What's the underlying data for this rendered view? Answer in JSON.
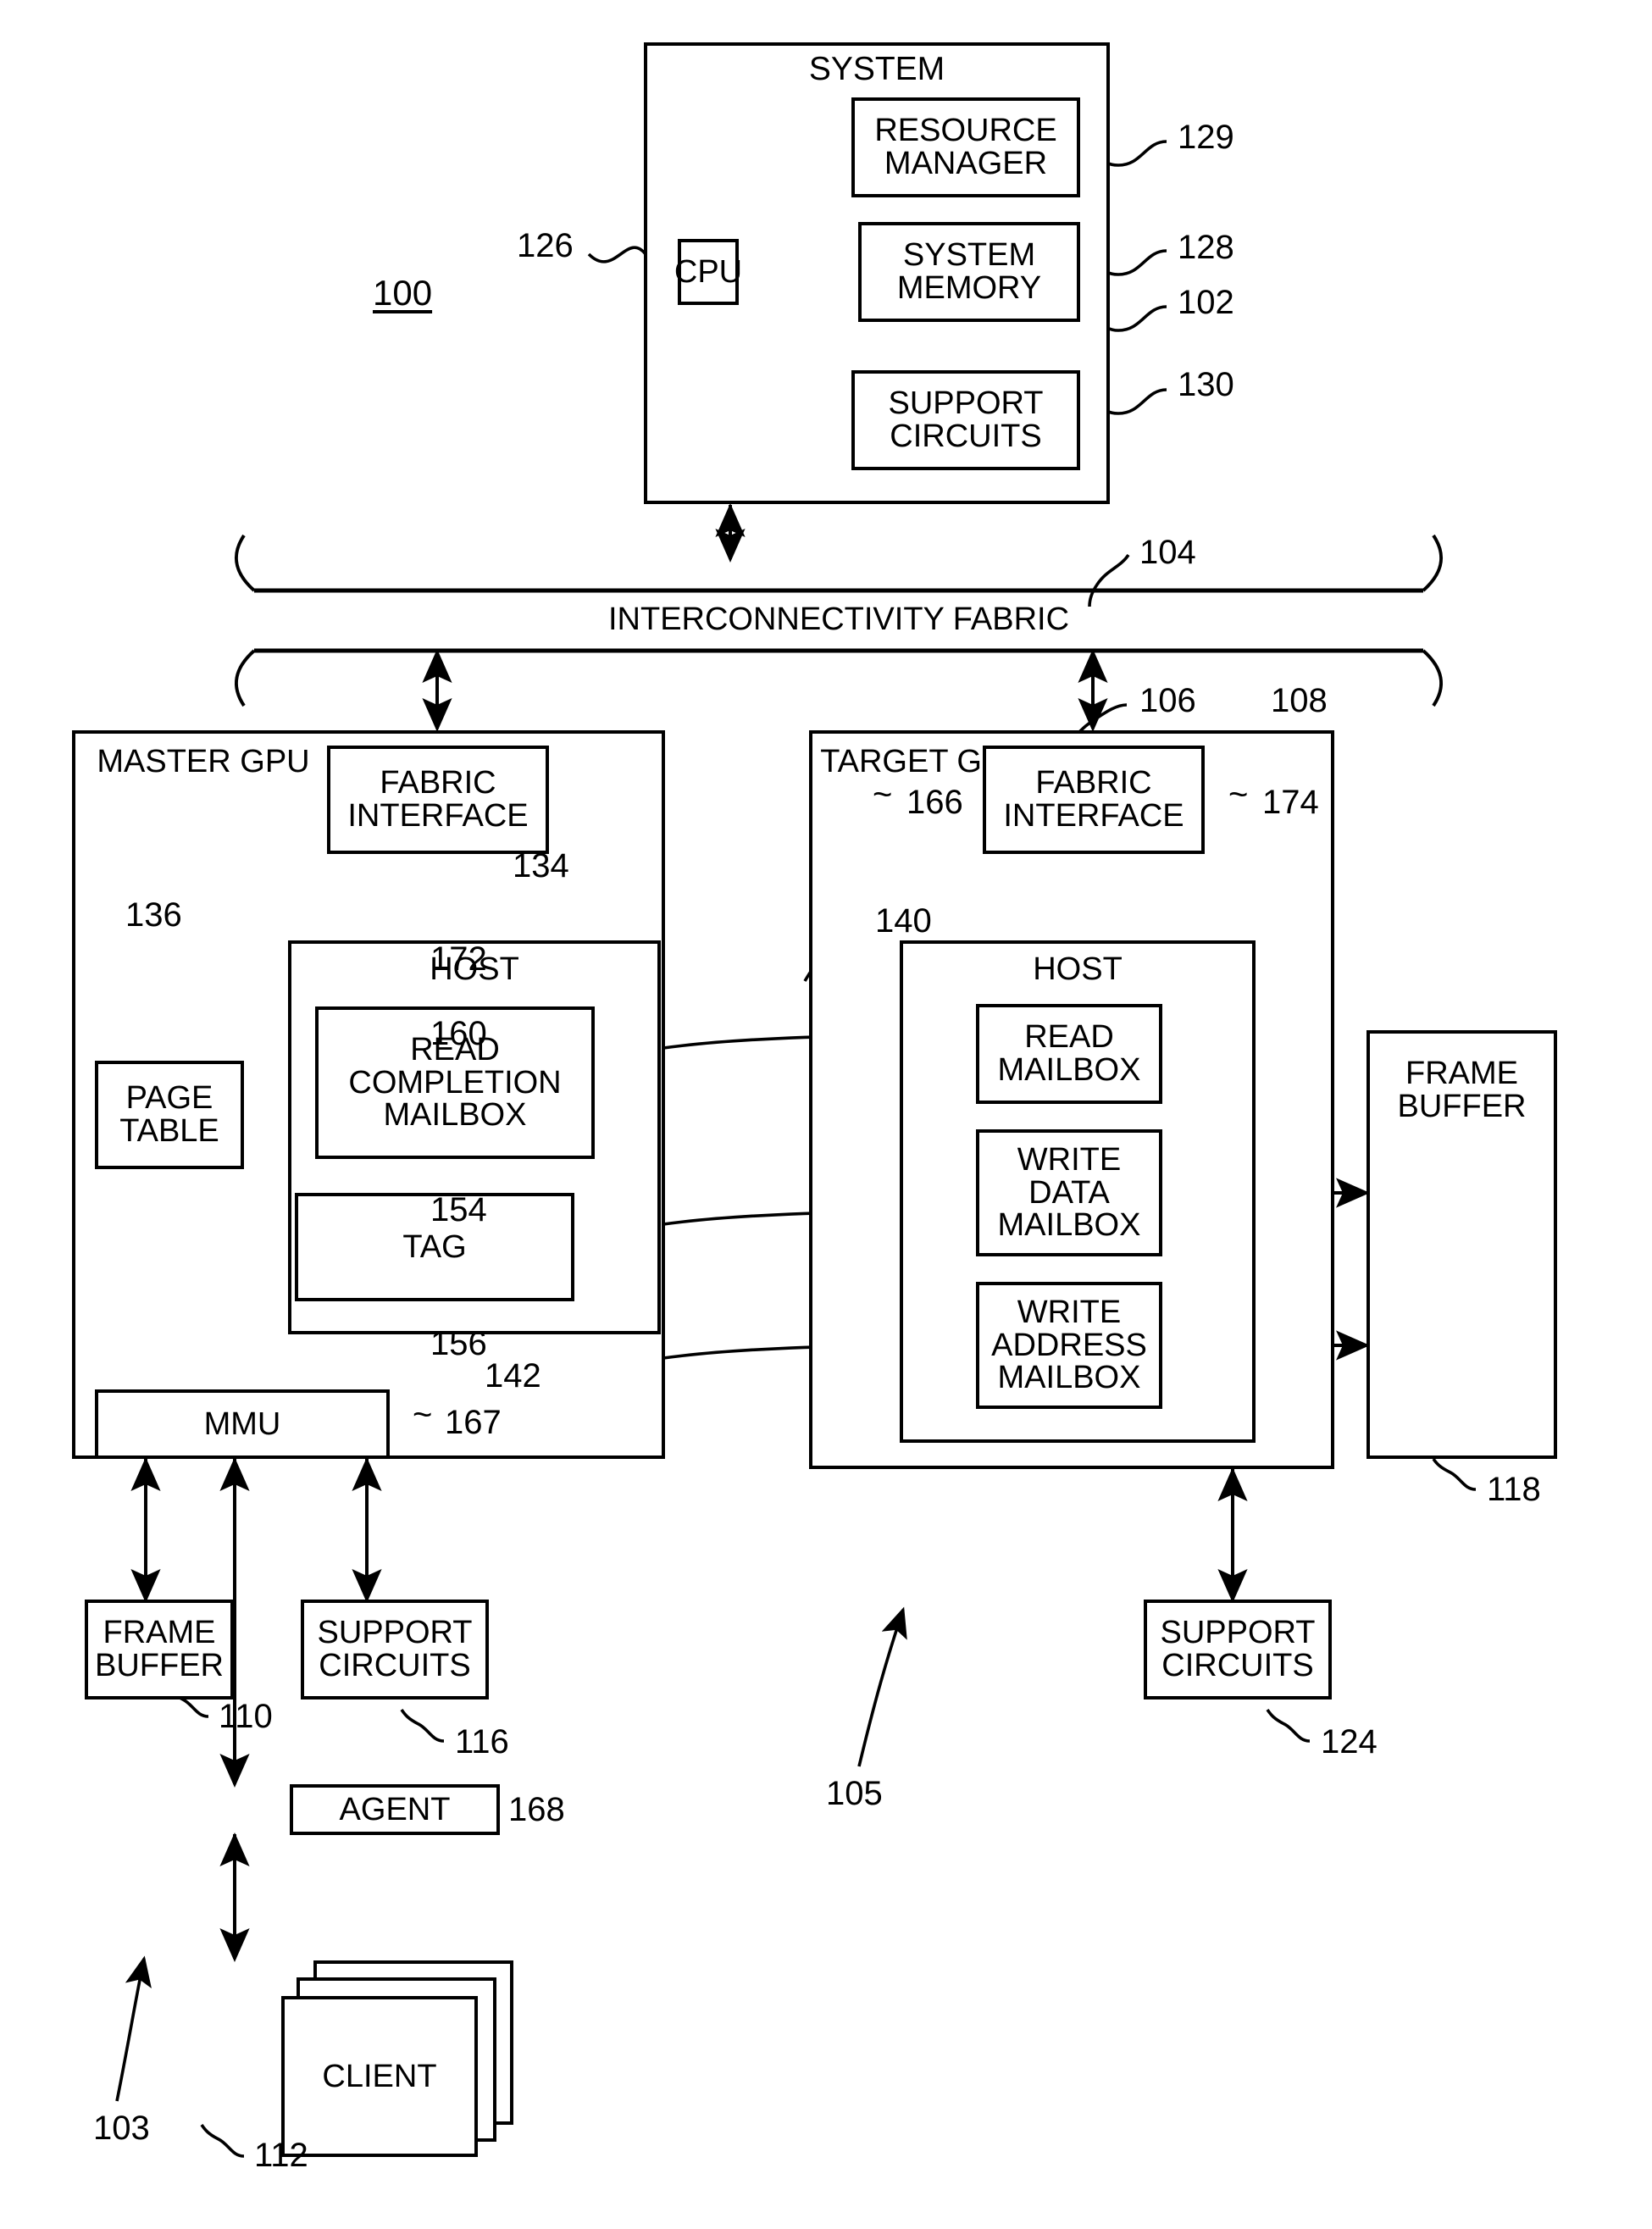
{
  "figure": {
    "figure_ref": "100",
    "detail_ref_left": "103",
    "detail_ref_right": "105"
  },
  "system": {
    "title": "SYSTEM",
    "ref": "102",
    "cpu": {
      "label": "CPU",
      "ref": "126"
    },
    "resource_manager": {
      "line1": "RESOURCE",
      "line2": "MANAGER",
      "ref": "129"
    },
    "system_memory": {
      "line1": "SYSTEM",
      "line2": "MEMORY",
      "ref": "128"
    },
    "support_circuits": {
      "line1": "SUPPORT",
      "line2": "CIRCUITS",
      "ref": "130"
    }
  },
  "fabric": {
    "label": "INTERCONNECTIVITY FABRIC",
    "ref": "104"
  },
  "master_gpu": {
    "title_line1": "MASTER",
    "title_line2": "GPU",
    "ref": "106",
    "fabric_interface": {
      "line1": "FABRIC",
      "line2": "INTERFACE",
      "ref": "166"
    },
    "host": {
      "title": "HOST",
      "ref": "134"
    },
    "read_completion_mailbox": {
      "line1": "READ",
      "line2": "COMPLETION",
      "line3": "MAILBOX",
      "ref": "140"
    },
    "tag": {
      "label": "TAG",
      "ref": "142"
    },
    "page_table": {
      "line1": "PAGE",
      "line2": "TABLE",
      "ref": "136"
    },
    "mmu": {
      "label": "MMU",
      "ref": "167"
    },
    "frame_buffer": {
      "line1": "FRAME",
      "line2": "BUFFER",
      "ref": "110"
    },
    "support_circuits": {
      "line1": "SUPPORT",
      "line2": "CIRCUITS",
      "ref": "116"
    },
    "agent": {
      "label": "AGENT",
      "ref": "168"
    },
    "client": {
      "label": "CLIENT",
      "ref": "112"
    }
  },
  "target_gpu": {
    "title_line1": "TARGET",
    "title_line2": "GPU",
    "ref": "108",
    "fabric_interface": {
      "line1": "FABRIC",
      "line2": "INTERFACE",
      "ref": "174"
    },
    "host": {
      "title": "HOST",
      "ref": "172"
    },
    "read_mailbox": {
      "line1": "READ",
      "line2": "MAILBOX",
      "ref": "160"
    },
    "write_data_mailbox": {
      "line1": "WRITE",
      "line2": "DATA",
      "line3": "MAILBOX",
      "ref": "154"
    },
    "write_address_mailbox": {
      "line1": "WRITE",
      "line2": "ADDRESS",
      "line3": "MAILBOX",
      "ref": "156"
    },
    "frame_buffer": {
      "line1": "FRAME",
      "line2": "BUFFER",
      "ref": "118"
    },
    "support_circuits": {
      "line1": "SUPPORT",
      "line2": "CIRCUITS",
      "ref": "124"
    }
  }
}
